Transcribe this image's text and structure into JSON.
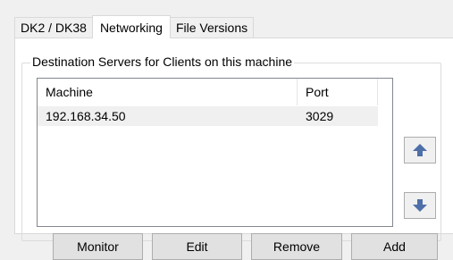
{
  "tabs": [
    {
      "label": "DK2 / DK38",
      "active": false
    },
    {
      "label": "Networking",
      "active": true
    },
    {
      "label": "File Versions",
      "active": false
    }
  ],
  "group": {
    "legend": "Destination Servers for Clients on this machine"
  },
  "list": {
    "columns": [
      "Machine",
      "Port"
    ],
    "rows": [
      {
        "machine": "192.168.34.50",
        "port": "3029"
      }
    ]
  },
  "side_buttons": {
    "up_icon": "arrow-up-icon",
    "down_icon": "arrow-down-icon",
    "arrow_color": "#4f6fa8"
  },
  "buttons": {
    "monitor": "Monitor",
    "edit": "Edit",
    "remove": "Remove",
    "add": "Add"
  }
}
